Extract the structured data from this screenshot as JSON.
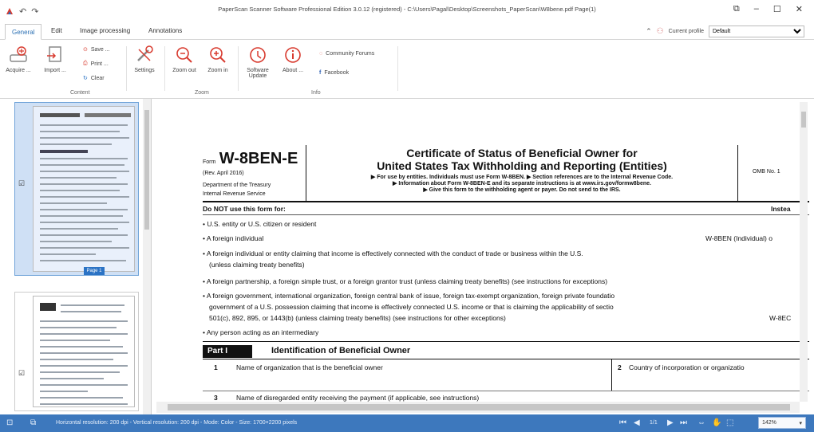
{
  "app": {
    "title": "PaperScan Scanner Software Professional Edition 3.0.12 (registered) - C:\\Users\\Pagal\\Desktop\\Screenshots_PaperScan\\W8bene.pdf Page(1)"
  },
  "tabs": [
    "General",
    "Edit",
    "Image processing",
    "Annotations"
  ],
  "profile": {
    "label": "Current profile",
    "value": "Default"
  },
  "ribbon": {
    "acquire": "Acquire ...",
    "import": "Import ...",
    "save": "Save ...",
    "print": "Print ...",
    "clear": "Clear",
    "settings": "Settings",
    "zoom_out": "Zoom out",
    "zoom_in": "Zoom in",
    "software_update": "Software Update",
    "about": "About ...",
    "community": "Community Forums",
    "facebook": "Facebook",
    "groups": {
      "content": "Content",
      "zoom": "Zoom",
      "info": "Info"
    }
  },
  "thumbnails": {
    "page1_label": "Page 1"
  },
  "document": {
    "form_prefix": "Form",
    "form_name": "W-8BEN-E",
    "rev": "(Rev. April 2016)",
    "dept1": "Department of the Treasury",
    "dept2": "Internal Revenue Service",
    "title1": "Certificate of Status of Beneficial Owner for",
    "title2": "United States Tax Withholding and Reporting (Entities)",
    "sub1": "▶ For use by entities. Individuals must use Form W-8BEN. ▶ Section references are to the Internal Revenue Code.",
    "sub2": "▶ Information about Form W-8BEN-E and its separate instructions is at www.irs.gov/formw8bene.",
    "sub3": "▶ Give this form to the withholding agent or payer. Do not send to the IRS.",
    "omb": "OMB No. 1",
    "do_not": "Do NOT use this form for:",
    "instead": "Instea",
    "items": [
      "• U.S. entity or U.S. citizen or resident",
      "• A foreign individual",
      "• A foreign individual or entity claiming that income is effectively connected with the conduct of trade or business within the U.S.",
      "(unless claiming treaty benefits)",
      "• A foreign partnership, a foreign simple trust, or a foreign grantor trust (unless claiming treaty benefits) (see instructions for exceptions)",
      "• A foreign government, international organization, foreign central bank of issue, foreign tax-exempt organization, foreign private foundatio",
      "government of a U.S. possession claiming that income is effectively connected U.S. income or that is claiming the applicability of sectio",
      "501(c), 892, 895, or 1443(b) (unless claiming treaty benefits) (see instructions for other exceptions)",
      "• Any person acting as an intermediary"
    ],
    "right_w8ben": "W-8BEN (Individual) o",
    "right_w8eci": "W-8EC",
    "part": "Part I",
    "part_title": "Identification of Beneficial Owner",
    "line1_num": "1",
    "line1": "Name of organization that is the beneficial owner",
    "line2_num": "2",
    "line2": "Country of incorporation or organizatio",
    "line3_num": "3",
    "line3": "Name of disregarded entity receiving the payment (if applicable, see instructions)"
  },
  "status": {
    "text": "Horizontal resolution: 200 dpi - Vertical resolution: 200 dpi - Mode: Color - Size: 1700×2200 pixels",
    "page": "1/1",
    "zoom": "142%"
  }
}
